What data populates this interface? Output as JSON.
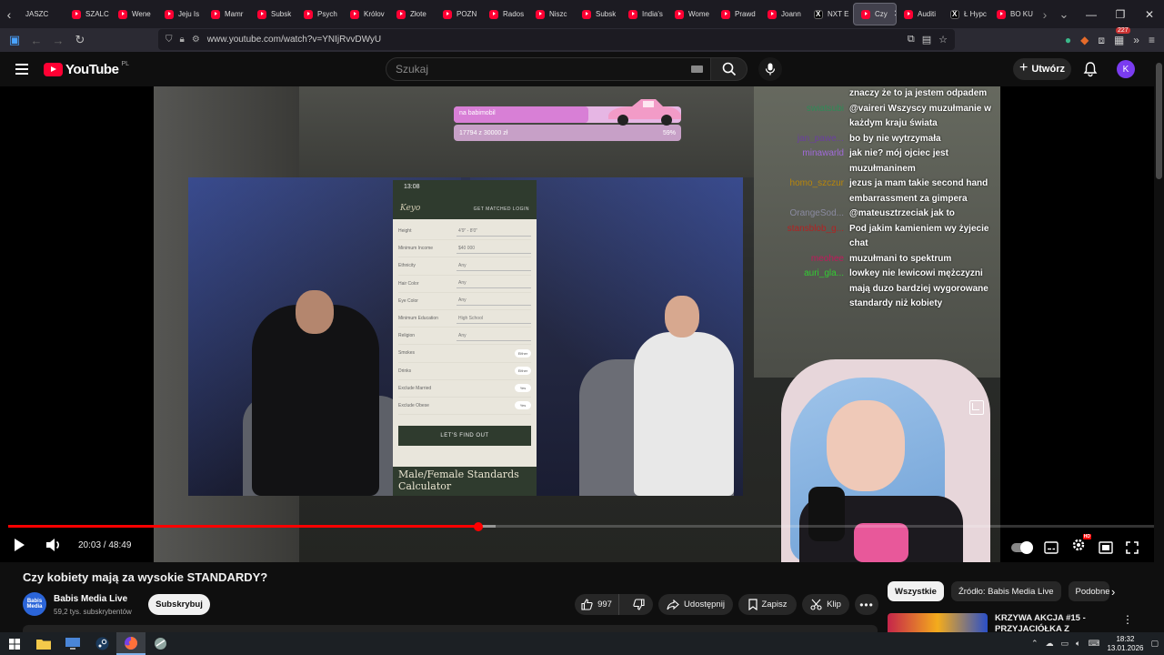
{
  "browser": {
    "tabs": [
      {
        "label": "JASZC",
        "fav": "none"
      },
      {
        "label": "SZALC",
        "fav": "yt"
      },
      {
        "label": "Wene",
        "fav": "yt"
      },
      {
        "label": "Jeju Is",
        "fav": "yt"
      },
      {
        "label": "Mamr",
        "fav": "yt"
      },
      {
        "label": "Subsk",
        "fav": "yt"
      },
      {
        "label": "Psych",
        "fav": "yt"
      },
      {
        "label": "Królov",
        "fav": "yt"
      },
      {
        "label": "Złote",
        "fav": "yt"
      },
      {
        "label": "POZN",
        "fav": "yt"
      },
      {
        "label": "Rados",
        "fav": "yt"
      },
      {
        "label": "Niszc",
        "fav": "yt"
      },
      {
        "label": "Subsk",
        "fav": "yt"
      },
      {
        "label": "India's",
        "fav": "yt"
      },
      {
        "label": "Wome",
        "fav": "yt"
      },
      {
        "label": "Prawd",
        "fav": "yt"
      },
      {
        "label": "Joann",
        "fav": "yt"
      },
      {
        "label": "NXT E",
        "fav": "x"
      },
      {
        "label": "Czy",
        "fav": "yt",
        "active": true
      },
      {
        "label": "Auditi",
        "fav": "yt"
      },
      {
        "label": "Ł Hypc",
        "fav": "x"
      },
      {
        "label": "BO KU",
        "fav": "yt"
      }
    ],
    "url": "www.youtube.com/watch?v=YNIjRvvDWyU",
    "ext_badge": "227"
  },
  "youtube": {
    "logo_text": "YouTube",
    "logo_region": "PL",
    "search_placeholder": "Szukaj",
    "create_label": "Utwórz",
    "avatar_letter": "K"
  },
  "stream": {
    "donation_label": "na babimobil",
    "donation_amount": "17794  z  30000  zł",
    "donation_percent": "59%",
    "donation_progress": 0.59,
    "phone": {
      "time": "13:08",
      "logo": "Keyo",
      "nav": "GET MATCHED    LOGIN",
      "rows": [
        {
          "label": "Height",
          "type": "slider",
          "value": "4'9\" - 8'0\""
        },
        {
          "label": "Minimum Income",
          "type": "slider",
          "value": "$40 000"
        },
        {
          "label": "Ethnicity",
          "type": "select",
          "value": "Any"
        },
        {
          "label": "Hair Color",
          "type": "select",
          "value": "Any"
        },
        {
          "label": "Eye Color",
          "type": "select",
          "value": "Any"
        },
        {
          "label": "Minimum Education",
          "type": "select",
          "value": "High School"
        },
        {
          "label": "Religion",
          "type": "select",
          "value": "Any"
        },
        {
          "label": "Smokes",
          "type": "pill",
          "value": "Either"
        },
        {
          "label": "Drinks",
          "type": "pill",
          "value": "Either"
        },
        {
          "label": "Exclude Married",
          "type": "pill",
          "value": "Yes"
        },
        {
          "label": "Exclude Obese",
          "type": "pill",
          "value": "Yes"
        }
      ],
      "cta": "LET'S FIND OUT",
      "footer": "Male/Female Standards Calculator"
    },
    "chat": [
      {
        "user": "",
        "color": "#ffffff",
        "msg": "znaczy że to ja jestem odpadem"
      },
      {
        "user": "swiatsubi",
        "color": "#2e8b57",
        "msg": "@vaireri Wszyscy muzułmanie w"
      },
      {
        "user": "",
        "color": "#ffffff",
        "msg": "każdym kraju świata"
      },
      {
        "user": "jan_pawe...",
        "color": "#6b3fa0",
        "msg": "bo by nie wytrzymała"
      },
      {
        "user": "minawarld",
        "color": "#a06ad9",
        "msg": "jak nie? mój ojciec jest"
      },
      {
        "user": "",
        "color": "#ffffff",
        "msg": "muzułmaninem"
      },
      {
        "user": "homo_szczur",
        "color": "#b8860b",
        "msg": "jezus ja mam takie second hand"
      },
      {
        "user": "",
        "color": "#ffffff",
        "msg": "embarrassment za gimpera"
      },
      {
        "user": "OrangeSod...",
        "color": "#8a8aa0",
        "msg": "@mateusztrzeciak jak to"
      },
      {
        "user": "stansblob_g...",
        "color": "#b22222",
        "msg": "Pod jakim kamieniem wy żyjecie"
      },
      {
        "user": "",
        "color": "#ffffff",
        "msg": "chat"
      },
      {
        "user": "meohee",
        "color": "#c2185b",
        "msg": "muzułmani to spektrum"
      },
      {
        "user": "auri_gla...",
        "color": "#32cd32",
        "msg": "lowkey nie lewicowi mężczyzni"
      },
      {
        "user": "",
        "color": "#ffffff",
        "msg": "mają duzo bardziej wygorowane"
      },
      {
        "user": "",
        "color": "#ffffff",
        "msg": "standardy niż kobiety"
      }
    ]
  },
  "player": {
    "current_time": "20:03",
    "duration": "48:49",
    "time_display": "20:03 / 48:49",
    "played_fraction": 0.41,
    "buffered_fraction": 0.425
  },
  "video": {
    "title": "Czy kobiety mają za wysokie STANDARDY?",
    "channel_name": "Babis Media Live",
    "channel_subs": "59,2 tys. subskrybentów",
    "channel_avatar_text": "Babis Media",
    "subscribe_label": "Subskrybuj",
    "likes": "997",
    "share_label": "Udostępnij",
    "save_label": "Zapisz",
    "clip_label": "Klip"
  },
  "sidebar": {
    "chips": [
      "Wszystkie",
      "Źródło: Babis Media Live",
      "Podobne"
    ],
    "related_title": "KRZYWA AKCJA #15 - PRZYJACIÓŁKA Z"
  },
  "taskbar": {
    "time": "18:32",
    "date": "13.01.2026"
  }
}
